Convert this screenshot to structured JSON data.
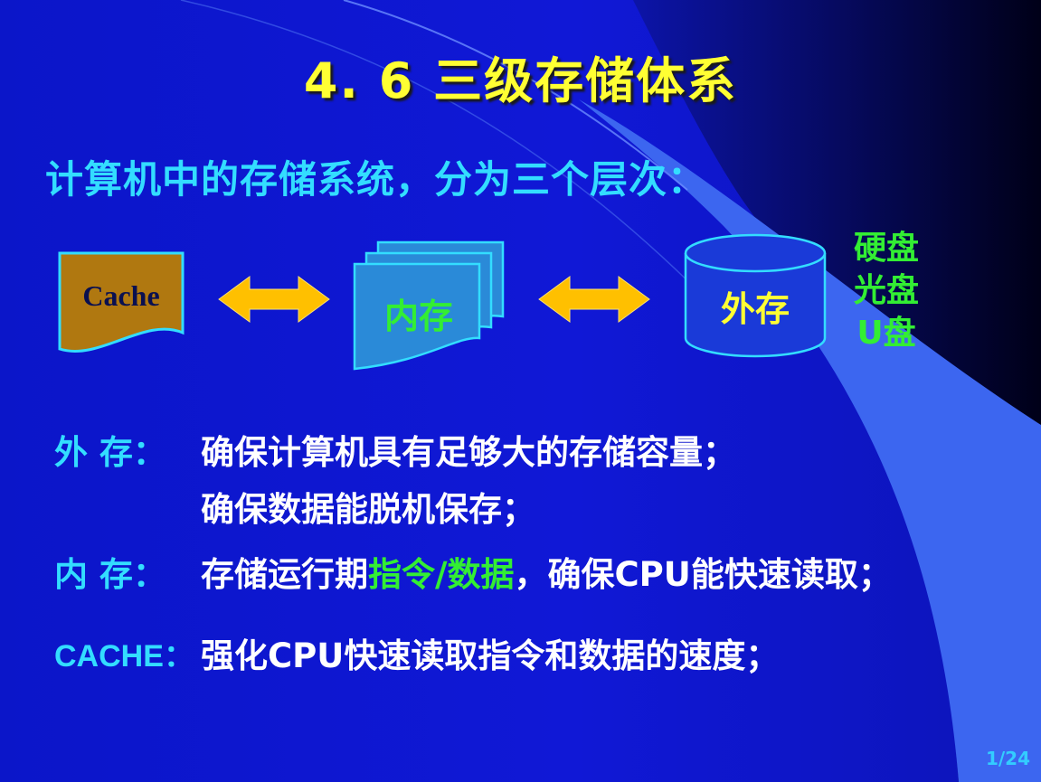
{
  "slide": {
    "title": "4. 6 三级存储体系",
    "intro": "计算机中的存储系统，分为三个层次：",
    "diagram": {
      "cache_label": "Cache",
      "memory_label": "内存",
      "storage_label": "外存",
      "storage_media": [
        "硬盘",
        "光盘",
        "U盘"
      ]
    },
    "rows": {
      "external_label": "外 存：",
      "external_line1": "确保计算机具有足够大的存储容量；",
      "external_line2": "确保数据能脱机保存；",
      "internal_label": "内 存：",
      "internal_pre": "存储运行期",
      "internal_highlight": "指令/数据",
      "internal_post": "，确保CPU能快速读取；",
      "cache_label": "CACHE：",
      "cache_text": "强化CPU快速读取指令和数据的速度；"
    },
    "page_number": "1/24"
  },
  "colors": {
    "background": "#1018d6",
    "title": "#ffff33",
    "label_cyan": "#33ddff",
    "highlight_green": "#33ee33",
    "arrow": "#ffc000",
    "cache_fill": "#b07810",
    "memory_fill": "#2a8ad8",
    "storage_fill": "#1a3ad8"
  },
  "icons": {
    "cache": "document-shape",
    "memory": "stacked-documents-shape",
    "storage": "cylinder-disk-shape",
    "arrows": "double-headed-arrow"
  }
}
